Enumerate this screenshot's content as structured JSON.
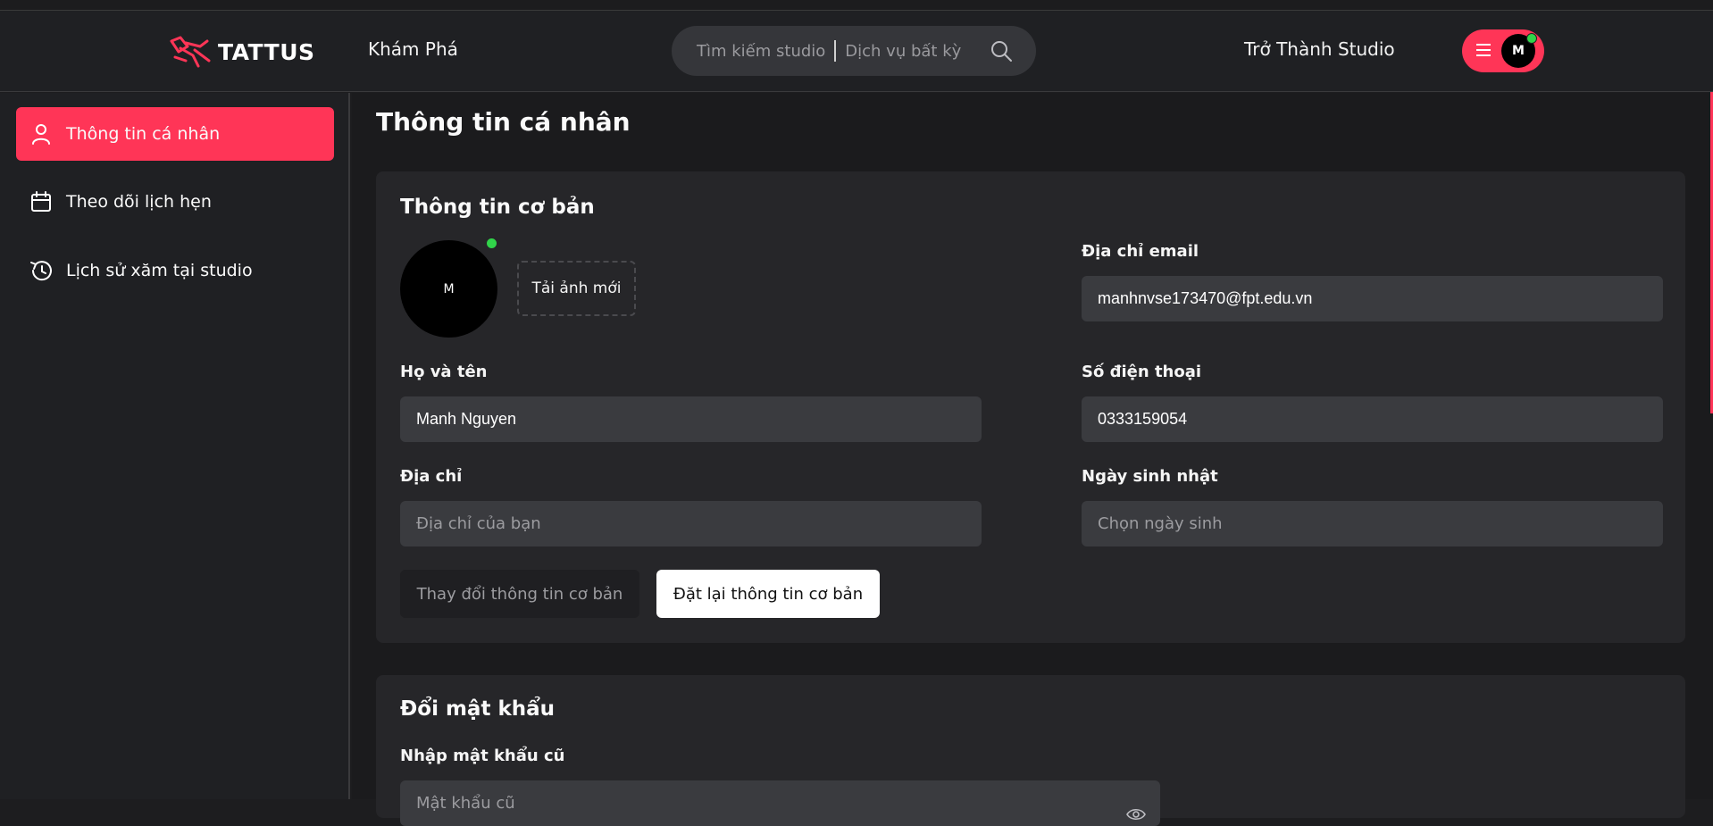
{
  "header": {
    "logo_text": "TATTUS",
    "nav_explore": "Khám Phá",
    "search": {
      "studio_placeholder": "Tìm kiếm studio",
      "service_placeholder": "Dịch vụ bất kỳ"
    },
    "become_studio": "Trở Thành Studio",
    "user_initial": "M"
  },
  "sidebar": {
    "items": [
      {
        "label": "Thông tin cá nhân",
        "icon": "user-icon",
        "active": true
      },
      {
        "label": "Theo dõi lịch hẹn",
        "icon": "calendar-icon",
        "active": false
      },
      {
        "label": "Lịch sử xăm tại studio",
        "icon": "history-icon",
        "active": false
      }
    ]
  },
  "main": {
    "page_title": "Thông tin cá nhân",
    "basic": {
      "title": "Thông tin cơ bản",
      "avatar_initial": "M",
      "upload_label": "Tải ảnh mới",
      "email_label": "Địa chỉ email",
      "email_value": "manhnvse173470@fpt.edu.vn",
      "name_label": "Họ và tên",
      "name_value": "Manh Nguyen",
      "phone_label": "Số điện thoại",
      "phone_value": "0333159054",
      "address_label": "Địa chỉ",
      "address_placeholder": "Địa chỉ của bạn",
      "birthday_label": "Ngày sinh nhật",
      "birthday_placeholder": "Chọn ngày sinh",
      "change_button": "Thay đổi thông tin cơ bản",
      "reset_button": "Đặt lại thông tin cơ bản"
    },
    "password": {
      "title": "Đổi mật khẩu",
      "old_label": "Nhập mật khẩu cũ",
      "old_placeholder": "Mật khẩu cũ"
    }
  },
  "colors": {
    "accent": "#ff3557",
    "online": "#31d44a",
    "background": "#1b1b1d",
    "card": "#262629"
  }
}
